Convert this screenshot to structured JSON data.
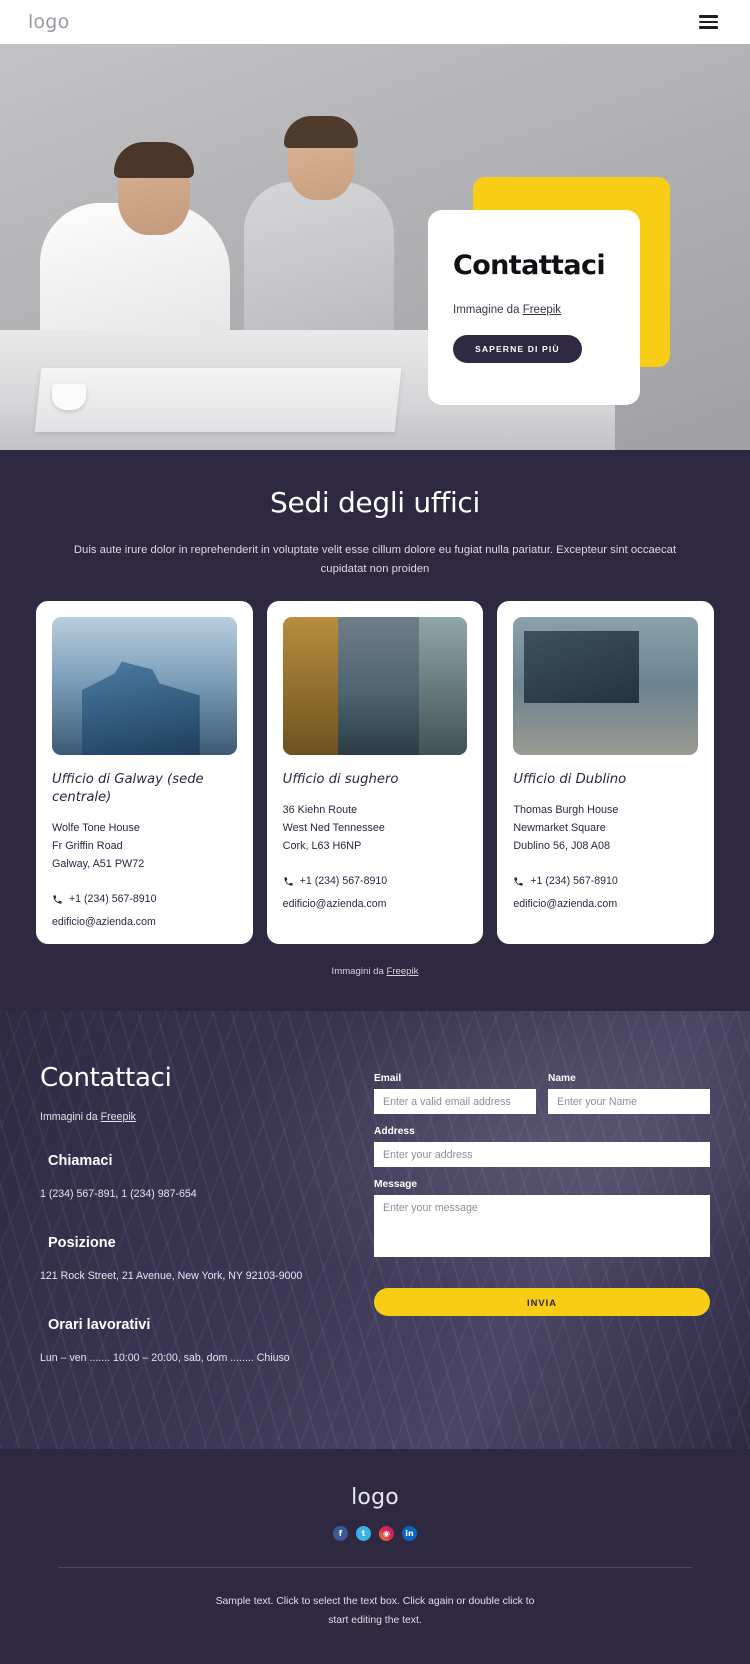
{
  "header": {
    "logo": "logo",
    "menu_icon": "hamburger-icon"
  },
  "hero": {
    "title": "Contattaci",
    "credit_prefix": "Immagine da ",
    "credit_link": "Freepik",
    "button": "SAPERNE DI PIÙ",
    "accent_color": "#f7ce15",
    "card_color": "#ffffff",
    "button_color": "#2e2840"
  },
  "offices": {
    "title": "Sedi degli uffici",
    "subtitle_line1": "Duis aute irure dolor in reprehenderit in voluptate velit esse cillum dolore eu fugiat nulla pariatur.",
    "subtitle_line2": "Excepteur sint occaecat cupidatat non proiden",
    "background_color": "#2e2840",
    "credit_prefix": "Immagini da ",
    "credit_link": "Freepik",
    "cards": [
      {
        "title": "Ufficio di Galway (sede centrale)",
        "address": [
          "Wolfe Tone House",
          "Fr Griffin Road",
          "Galway, A51 PW72"
        ],
        "phone": "+1 (234) 567-8910",
        "email": "edificio@azienda.com",
        "image_alt": "glass-office-towers-photo"
      },
      {
        "title": "Ufficio di sughero",
        "address": [
          "36 Kiehn Route",
          "West Ned Tennessee",
          "Cork, L63 H6NP"
        ],
        "phone": "+1 (234) 567-8910",
        "email": "edificio@azienda.com",
        "image_alt": "glass-corridor-photo"
      },
      {
        "title": "Ufficio di Dublino",
        "address": [
          "Thomas Burgh House",
          "Newmarket Square",
          "Dublino 56, J08 A08"
        ],
        "phone": "+1 (234) 567-8910",
        "email": "edificio@azienda.com",
        "image_alt": "modern-building-plaza-photo"
      }
    ]
  },
  "contact": {
    "heading": "Contattaci",
    "credit_prefix": "Immagini da ",
    "credit_link": "Freepik",
    "blocks": [
      {
        "title": "Chiamaci",
        "text": "1 (234) 567-891, 1 (234) 987-654"
      },
      {
        "title": "Posizione",
        "text": "121 Rock Street, 21 Avenue, New York, NY 92103-9000"
      },
      {
        "title": "Orari lavorativi",
        "text": "Lun – ven ....... 10:00 – 20:00, sab, dom ........ Chiuso"
      }
    ],
    "form": {
      "email_label": "Email",
      "email_placeholder": "Enter a valid email address",
      "email_value": "",
      "name_label": "Name",
      "name_placeholder": "Enter your Name",
      "name_value": "",
      "address_label": "Address",
      "address_placeholder": "Enter your address",
      "address_value": "",
      "message_label": "Message",
      "message_placeholder": "Enter your message",
      "message_value": "",
      "submit_label": "INVIA",
      "submit_color": "#f7ce15"
    }
  },
  "footer": {
    "logo": "logo",
    "socials": [
      {
        "name": "facebook",
        "glyph": "f",
        "color": "#3b5998"
      },
      {
        "name": "twitter",
        "glyph": "t",
        "color": "#3ab0e8"
      },
      {
        "name": "instagram",
        "glyph": "◉",
        "color": "#dc2743"
      },
      {
        "name": "linkedin",
        "glyph": "in",
        "color": "#0a66c2"
      }
    ],
    "note_line1": "Sample text. Click to select the text box. Click again or double click to",
    "note_line2": "start editing the text."
  }
}
